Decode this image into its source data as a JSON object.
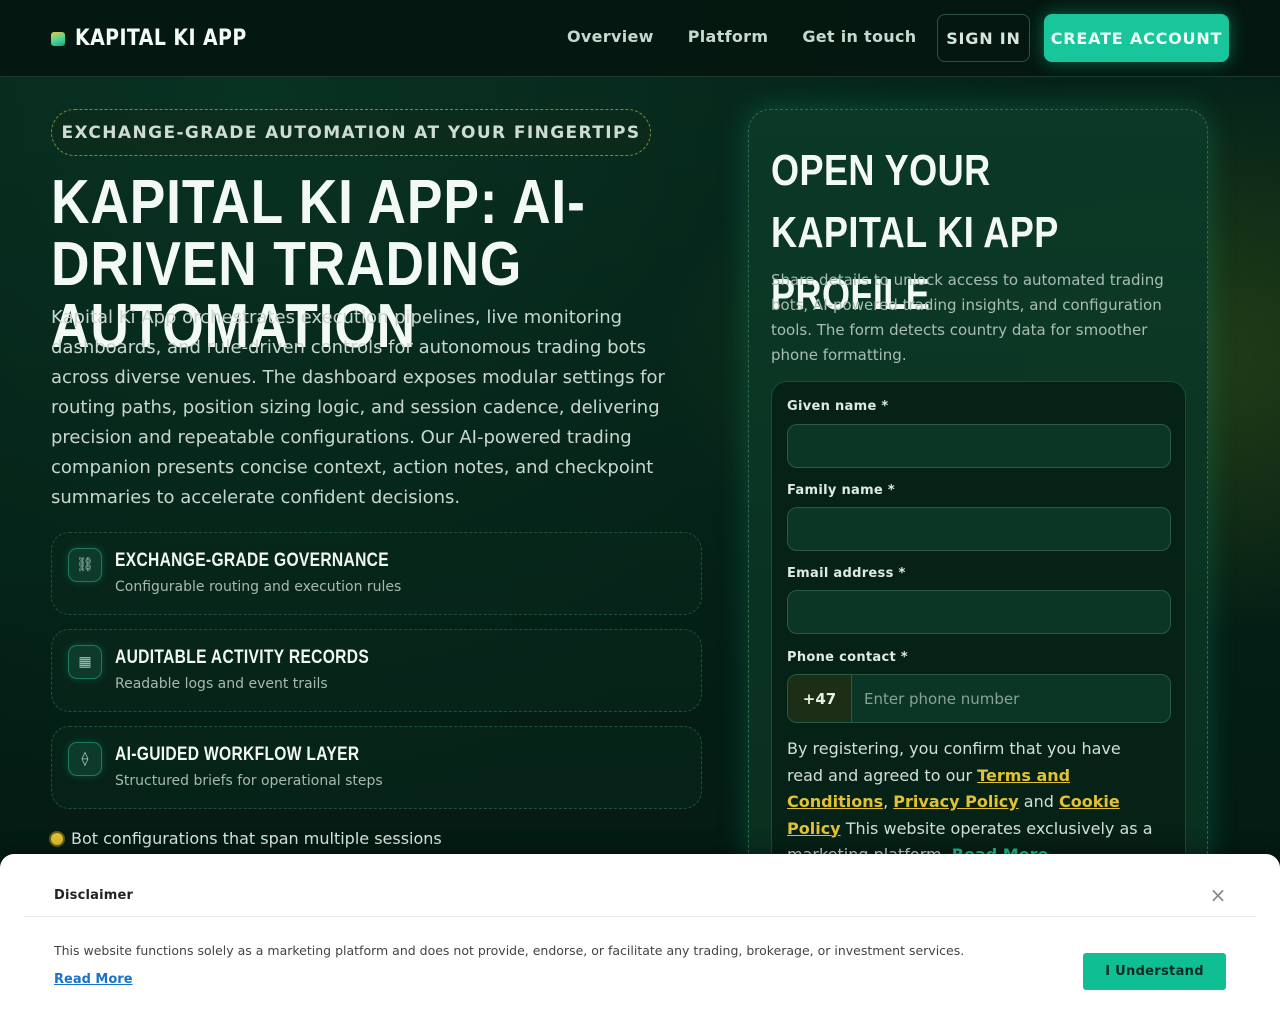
{
  "header": {
    "brand": "KAPITAL KI APP",
    "nav": [
      "Overview",
      "Platform",
      "Get in touch"
    ],
    "signin_label": "SIGN IN",
    "create_label": "CREATE ACCOUNT"
  },
  "hero": {
    "eyebrow": "EXCHANGE-GRADE AUTOMATION AT YOUR FINGERTIPS",
    "title": "KAPITAL KI APP: AI-DRIVEN TRADING AUTOMATION",
    "text": "Kapital Ki App orchestrates execution pipelines, live monitoring dashboards, and rule-driven controls for autonomous trading bots across diverse venues. The dashboard exposes modular settings for routing paths, position sizing logic, and session cadence, delivering precision and repeatable configurations. Our AI-powered trading companion presents concise context, action notes, and checkpoint summaries to accelerate confident decisions."
  },
  "features": [
    {
      "icon": "⛓",
      "title": "EXCHANGE-GRADE GOVERNANCE",
      "subtitle": "Configurable routing and execution rules"
    },
    {
      "icon": "▦",
      "title": "AUDITABLE ACTIVITY RECORDS",
      "subtitle": "Readable logs and event trails"
    },
    {
      "icon": "⟠",
      "title": "AI-GUIDED WORKFLOW LAYER",
      "subtitle": "Structured briefs for operational steps"
    }
  ],
  "bullet": "Bot configurations that span multiple sessions",
  "form": {
    "title": "OPEN YOUR KAPITAL KI APP PROFILE",
    "description": "Share details to unlock access to automated trading bots, AI-powered trading insights, and configuration tools. The form detects country data for smoother phone formatting.",
    "given_name_label": "Given name *",
    "family_name_label": "Family name *",
    "email_label": "Email address *",
    "phone_label": "Phone contact *",
    "phone_code": "+47",
    "phone_placeholder": "Enter phone number",
    "consent_pre": "By registering, you confirm that you have read and agreed to our ",
    "terms": "Terms and Conditions",
    "comma": ",",
    "privacy": "Privacy Policy",
    "and": " and ",
    "cookie": "Cookie Policy",
    "consent_post": " This website operates exclusively as a marketing platform. ",
    "read_more": "Read More"
  },
  "disclaimer": {
    "title": "Disclaimer",
    "close": "×",
    "text": "This website functions solely as a marketing platform and does not provide, endorse, or facilitate any trading, brokerage, or investment services.",
    "link": "Read More",
    "button": "I Understand"
  },
  "colors": {
    "accent": "#19c59a",
    "gold": "#e2c232",
    "background": "#031a12"
  }
}
